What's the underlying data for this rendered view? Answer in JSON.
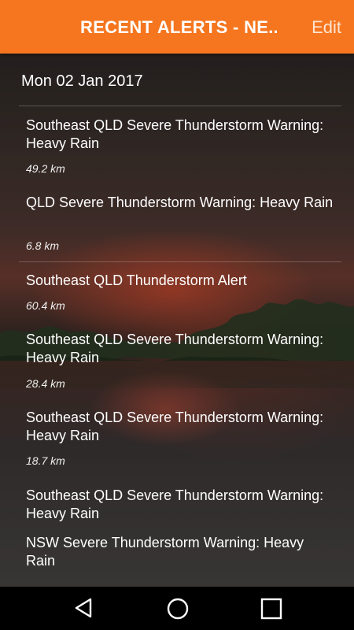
{
  "header": {
    "title": "RECENT ALERTS - NE..",
    "edit_label": "Edit"
  },
  "alerts_list": {
    "date": "Mon 02 Jan 2017",
    "items": [
      {
        "title": "Southeast QLD Severe Thunderstorm Warning: Heavy Rain",
        "distance": "49.2 km"
      },
      {
        "title": "QLD Severe Thunderstorm Warning: Heavy Rain",
        "distance": "6.8 km"
      },
      {
        "title": "Southeast QLD Thunderstorm Alert",
        "distance": "60.4 km"
      },
      {
        "title": "Southeast QLD Severe Thunderstorm Warning: Heavy Rain",
        "distance": "28.4 km"
      },
      {
        "title": "Southeast QLD Severe Thunderstorm Warning: Heavy Rain",
        "distance": "18.7 km"
      },
      {
        "title": "Southeast QLD Severe Thunderstorm Warning: Heavy Rain",
        "distance": ""
      },
      {
        "title": "NSW Severe Thunderstorm Warning: Heavy Rain",
        "distance": ""
      }
    ]
  },
  "nav": {
    "back_icon": "back-triangle-icon",
    "home_icon": "home-circle-icon",
    "recents_icon": "recents-square-icon"
  },
  "colors": {
    "accent": "#f5761f",
    "nav_background": "#000000"
  }
}
